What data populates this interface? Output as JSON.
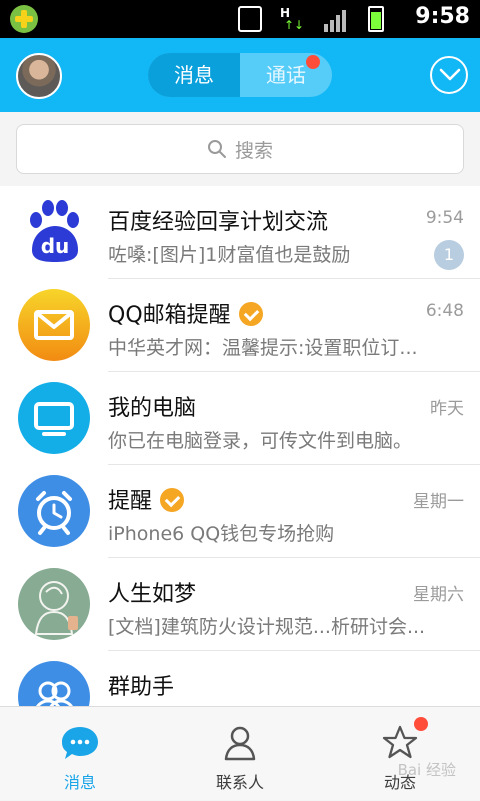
{
  "status_bar": {
    "time": "9:58"
  },
  "top_bar": {
    "segment_left": "消息",
    "segment_right": "通话"
  },
  "search": {
    "placeholder": "搜索"
  },
  "conversations": [
    {
      "name": "百度经验回享计划交流",
      "message": "咗嗓:[图片]1财富值也是鼓励",
      "time": "9:54",
      "badge": "1"
    },
    {
      "name": "QQ邮箱提醒",
      "message": "中华英才网：温馨提示:设置职位订...",
      "time": "6:48",
      "verified": true
    },
    {
      "name": "我的电脑",
      "message": "你已在电脑登录，可传文件到电脑。",
      "time": "昨天"
    },
    {
      "name": "提醒",
      "message": "iPhone6 QQ钱包专场抢购",
      "time": "星期一",
      "verified": true
    },
    {
      "name": "人生如梦",
      "message": "[文档]建筑防火设计规范...析研讨会...",
      "time": "星期六"
    },
    {
      "name": "群助手",
      "message": "",
      "time": ""
    }
  ],
  "tabs": [
    {
      "label": "消息"
    },
    {
      "label": "联系人"
    },
    {
      "label": "动态"
    }
  ],
  "watermark": "Bai 经验"
}
